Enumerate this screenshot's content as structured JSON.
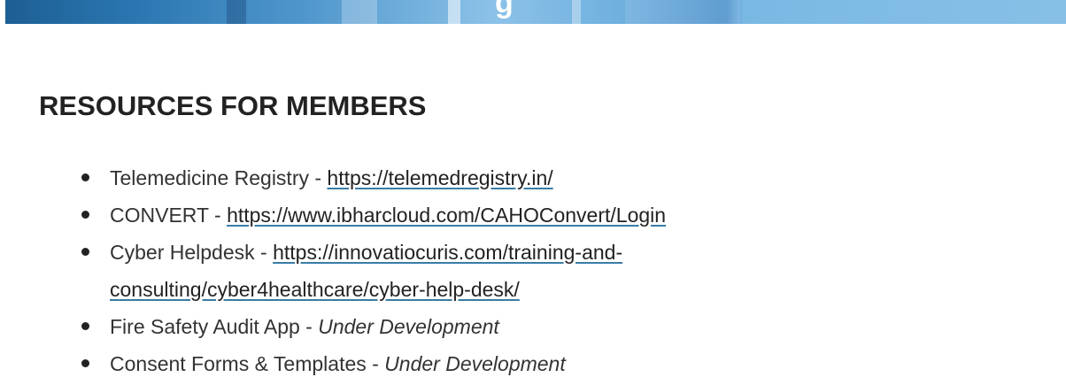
{
  "hero": {
    "glyph": "g"
  },
  "section": {
    "title": "RESOURCES FOR MEMBERS"
  },
  "resources": [
    {
      "label": "Telemedicine Registry - ",
      "link": "https://telemedregistry.in/"
    },
    {
      "label": "CONVERT - ",
      "link": "https://www.ibharcloud.com/CAHOConvert/Login"
    },
    {
      "label": "Cyber Helpdesk - ",
      "link": "https://innovatiocuris.com/training-and-consulting/cyber4healthcare/cyber-help-desk/"
    },
    {
      "label": "Fire Safety Audit App - ",
      "status": "Under Development"
    },
    {
      "label": "Consent Forms & Templates - ",
      "status": "Under Development"
    }
  ]
}
